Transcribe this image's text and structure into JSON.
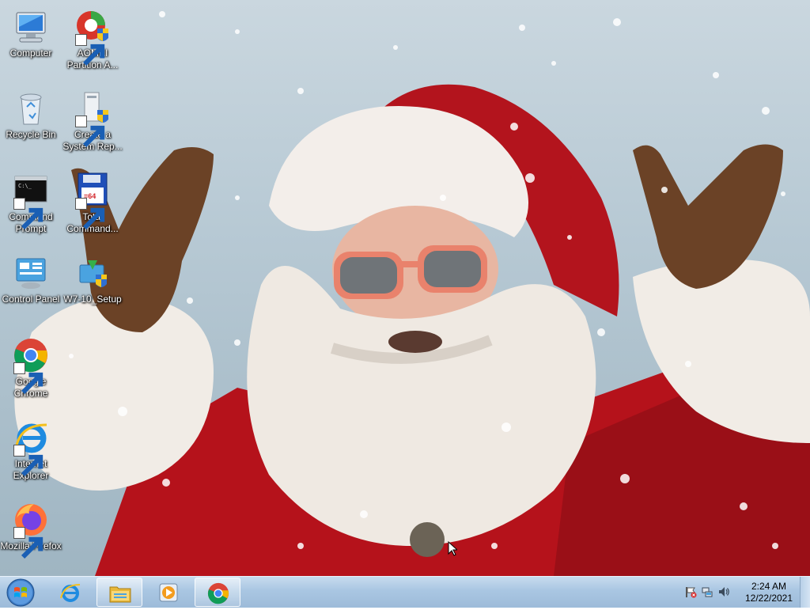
{
  "desktop": {
    "icons": [
      {
        "label": "Computer",
        "icon": "computer-icon",
        "shortcut": false
      },
      {
        "label": "AOMEI Partition A...",
        "icon": "aomei-partition-icon",
        "shortcut": true
      },
      {
        "label": "Recycle Bin",
        "icon": "recycle-bin-icon",
        "shortcut": false
      },
      {
        "label": "Create a System Rep...",
        "icon": "system-repair-disc-icon",
        "shortcut": true
      },
      {
        "label": "Command Prompt",
        "icon": "command-prompt-icon",
        "shortcut": true
      },
      {
        "label": "Total Command...",
        "icon": "total-commander-icon",
        "shortcut": true
      },
      {
        "label": "Control Panel",
        "icon": "control-panel-icon",
        "shortcut": false
      },
      {
        "label": "W7-10_Setup",
        "icon": "setup-icon",
        "shortcut": false
      },
      {
        "label": "Google Chrome",
        "icon": "chrome-icon",
        "shortcut": true
      },
      {
        "label": "Internet Explorer",
        "icon": "internet-explorer-icon",
        "shortcut": true
      },
      {
        "label": "Mozilla Firefox",
        "icon": "firefox-icon",
        "shortcut": true
      }
    ],
    "wallpaper": "santa-claus-wallpaper"
  },
  "taskbar": {
    "start_button": "windows-start-orb-icon",
    "pinned": [
      {
        "name": "Internet Explorer",
        "icon": "internet-explorer-icon",
        "open": false
      },
      {
        "name": "Windows Explorer",
        "icon": "folder-icon",
        "open": true
      },
      {
        "name": "Windows Media Player",
        "icon": "media-player-icon",
        "open": false
      },
      {
        "name": "Google Chrome",
        "icon": "chrome-icon",
        "open": true
      }
    ],
    "tray": {
      "icons": [
        "action-center-flag-icon",
        "network-icon",
        "volume-icon"
      ],
      "time": "2:24 AM",
      "date": "12/22/2021"
    },
    "colors": {
      "taskbar": "#a9c6e2",
      "text": "#000000"
    }
  }
}
